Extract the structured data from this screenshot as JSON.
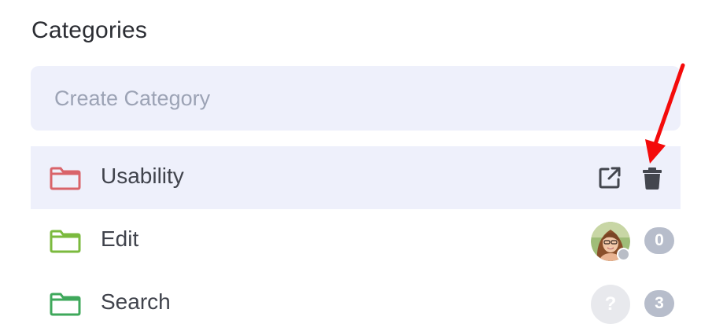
{
  "header": {
    "title": "Categories"
  },
  "create": {
    "placeholder": "Create Category",
    "value": ""
  },
  "categories": [
    {
      "label": "Usability",
      "folder_color": "#d9636a",
      "active": true,
      "actions": [
        "external-link-icon",
        "trash-icon"
      ]
    },
    {
      "label": "Edit",
      "folder_color": "#7bba3e",
      "assignee": "avatar-photo",
      "count": "0"
    },
    {
      "label": "Search",
      "folder_color": "#3fa85b",
      "assignee_placeholder": "?",
      "count": "3"
    }
  ],
  "colors": {
    "active_row_bg": "#eef0fb",
    "badge_bg": "#b7bdcb",
    "annotation_arrow": "#f40b0b"
  }
}
